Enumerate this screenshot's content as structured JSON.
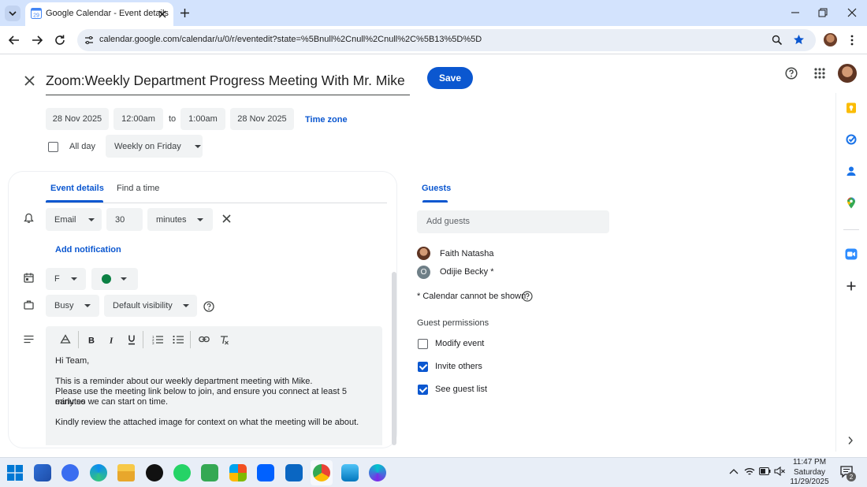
{
  "browser": {
    "tab_title": "Google Calendar - Event details",
    "url": "calendar.google.com/calendar/u/0/r/eventedit?state=%5Bnull%2Cnull%2Cnull%2C%5B13%5D%5D"
  },
  "event": {
    "title": "Zoom:Weekly Department Progress Meeting With Mr. Mike",
    "save_label": "Save",
    "start_date": "28 Nov 2025",
    "start_time": "12:00am",
    "to_label": "to",
    "end_time": "1:00am",
    "end_date": "28 Nov 2025",
    "timezone_label": "Time zone",
    "allday_label": "All day",
    "recurrence": "Weekly on Friday"
  },
  "tabs": {
    "details": "Event details",
    "find_time": "Find a time"
  },
  "notification": {
    "method": "Email",
    "amount": "30",
    "unit": "minutes",
    "add_label": "Add notification"
  },
  "calendar": {
    "name": "F",
    "color": "#0b8043"
  },
  "availability": {
    "busy": "Busy",
    "visibility": "Default visibility"
  },
  "description": {
    "lines": [
      "Hi Team,",
      "",
      "This is a reminder about our weekly department meeting with Mike.",
      "Please use the meeting link below to join, and ensure you connect at least 5 minutes",
      "early so we can start on time.",
      "",
      "Kindly review the attached image for context on what the meeting will be about."
    ]
  },
  "guests": {
    "tab_label": "Guests",
    "add_placeholder": "Add guests",
    "list": [
      {
        "name": "Faith Natasha",
        "initial": ""
      },
      {
        "name": "Odijie Becky *",
        "initial": "O"
      }
    ],
    "note": "* Calendar cannot be shown",
    "permissions_title": "Guest permissions",
    "permissions": [
      {
        "label": "Modify event",
        "checked": false
      },
      {
        "label": "Invite others",
        "checked": true
      },
      {
        "label": "See guest list",
        "checked": true
      }
    ]
  },
  "taskbar": {
    "time": "11:47 PM",
    "day": "Saturday",
    "date": "11/29/2025",
    "notif_count": "2"
  },
  "colors": {
    "accent": "#0b57d0",
    "tabstrip": "#d3e3fd"
  }
}
